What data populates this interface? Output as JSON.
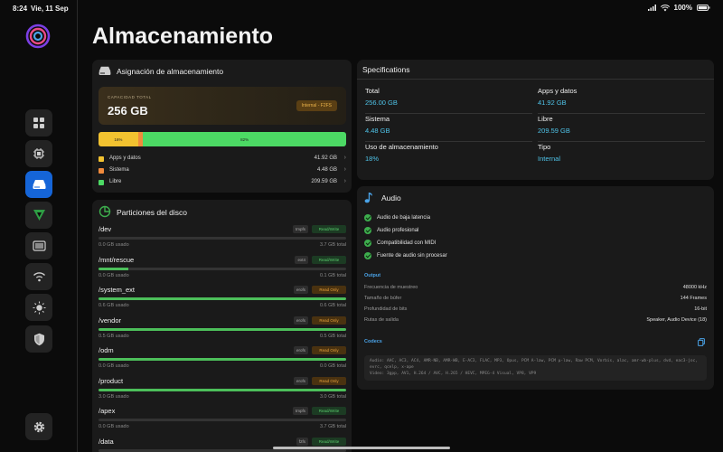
{
  "status_bar": {
    "time": "8:24",
    "date": "Vie, 11 Sep",
    "battery": "100%"
  },
  "page_title": "Almacenamiento",
  "allocation": {
    "title": "Asignación de almacenamiento",
    "capacity_label": "CAPACIDAD TOTAL",
    "capacity_value": "256 GB",
    "badge": "Internal - F2FS",
    "bar": [
      {
        "label": "16%",
        "fraction": 0.16,
        "color": "#f2c230"
      },
      {
        "label": "",
        "fraction": 0.02,
        "color": "#f08a3c"
      },
      {
        "label": "82%",
        "fraction": 0.82,
        "color": "#4cd964"
      }
    ],
    "legend": [
      {
        "label": "Apps y datos",
        "value": "41.92 GB",
        "color": "#f2c230"
      },
      {
        "label": "Sistema",
        "value": "4.48 GB",
        "color": "#f08a3c"
      },
      {
        "label": "Libre",
        "value": "209.59 GB",
        "color": "#4cd964"
      }
    ]
  },
  "partitions": {
    "title": "Particiones del disco",
    "items": [
      {
        "name": "/dev",
        "fs": "tmpfs",
        "mode": "Read/Write",
        "mode_type": "rw",
        "used": "0.0 GB usado",
        "total": "3.7 GB total",
        "fraction": 0.0
      },
      {
        "name": "/mnt/rescue",
        "fs": "ext4",
        "mode": "Read/Write",
        "mode_type": "rw",
        "used": "0.0 GB usado",
        "total": "0.1 GB total",
        "fraction": 0.12
      },
      {
        "name": "/system_ext",
        "fs": "erofs",
        "mode": "Read Only",
        "mode_type": "ro",
        "used": "0.6 GB usado",
        "total": "0.6 GB total",
        "fraction": 1.0
      },
      {
        "name": "/vendor",
        "fs": "erofs",
        "mode": "Read Only",
        "mode_type": "ro",
        "used": "0.5 GB usado",
        "total": "0.5 GB total",
        "fraction": 1.0
      },
      {
        "name": "/odm",
        "fs": "erofs",
        "mode": "Read Only",
        "mode_type": "ro",
        "used": "0.0 GB usado",
        "total": "0.0 GB total",
        "fraction": 1.0
      },
      {
        "name": "/product",
        "fs": "erofs",
        "mode": "Read Only",
        "mode_type": "ro",
        "used": "3.0 GB usado",
        "total": "3.0 GB total",
        "fraction": 1.0
      },
      {
        "name": "/apex",
        "fs": "tmpfs",
        "mode": "Read/Write",
        "mode_type": "rw",
        "used": "0.0 GB usado",
        "total": "3.7 GB total",
        "fraction": 0.0
      },
      {
        "name": "/data",
        "fs": "f2fs",
        "mode": "Read/Write",
        "mode_type": "rw",
        "used": "",
        "total": "",
        "fraction": 0.0
      }
    ]
  },
  "specifications": {
    "title": "Specifications",
    "items": [
      {
        "key": "Total",
        "value": "256.00 GB"
      },
      {
        "key": "Apps y datos",
        "value": "41.92 GB"
      },
      {
        "key": "Sistema",
        "value": "4.48 GB"
      },
      {
        "key": "Libre",
        "value": "209.59 GB"
      },
      {
        "key": "Uso de almacenamiento",
        "value": "18%"
      },
      {
        "key": "Tipo",
        "value": "Internal"
      }
    ]
  },
  "audio": {
    "title": "Audio",
    "features": [
      "Audio de baja latencia",
      "Audio profesional",
      "Compatibilidad con MIDI",
      "Fuente de audio sin procesar"
    ],
    "output_heading": "Output",
    "output": [
      {
        "key": "Frecuencia de muestreo",
        "value": "48000 kHz"
      },
      {
        "key": "Tamaño de búfer",
        "value": "144 Frames"
      },
      {
        "key": "Profundidad de bits",
        "value": "16-bit"
      },
      {
        "key": "Rutas de salida",
        "value": "Speaker, Audio Device (18)"
      }
    ],
    "codecs_heading": "Codecs",
    "codecs_audio": "Audio: AAC, AC3, AC4, AMR-NB, AMR-WB, E-AC3, FLAC, MP3, Opus, PCM A-law, PCM μ-law, Raw PCM, Vorbis, alac, amr-wb-plus, dvd, eac3-joc, evrc, qcelp, x-ape",
    "codecs_video": "Video: 3gpp, AV1, H.264 / AVC, H.265 / HEVC, MPEG-4 Visual, VP8, VP9"
  }
}
